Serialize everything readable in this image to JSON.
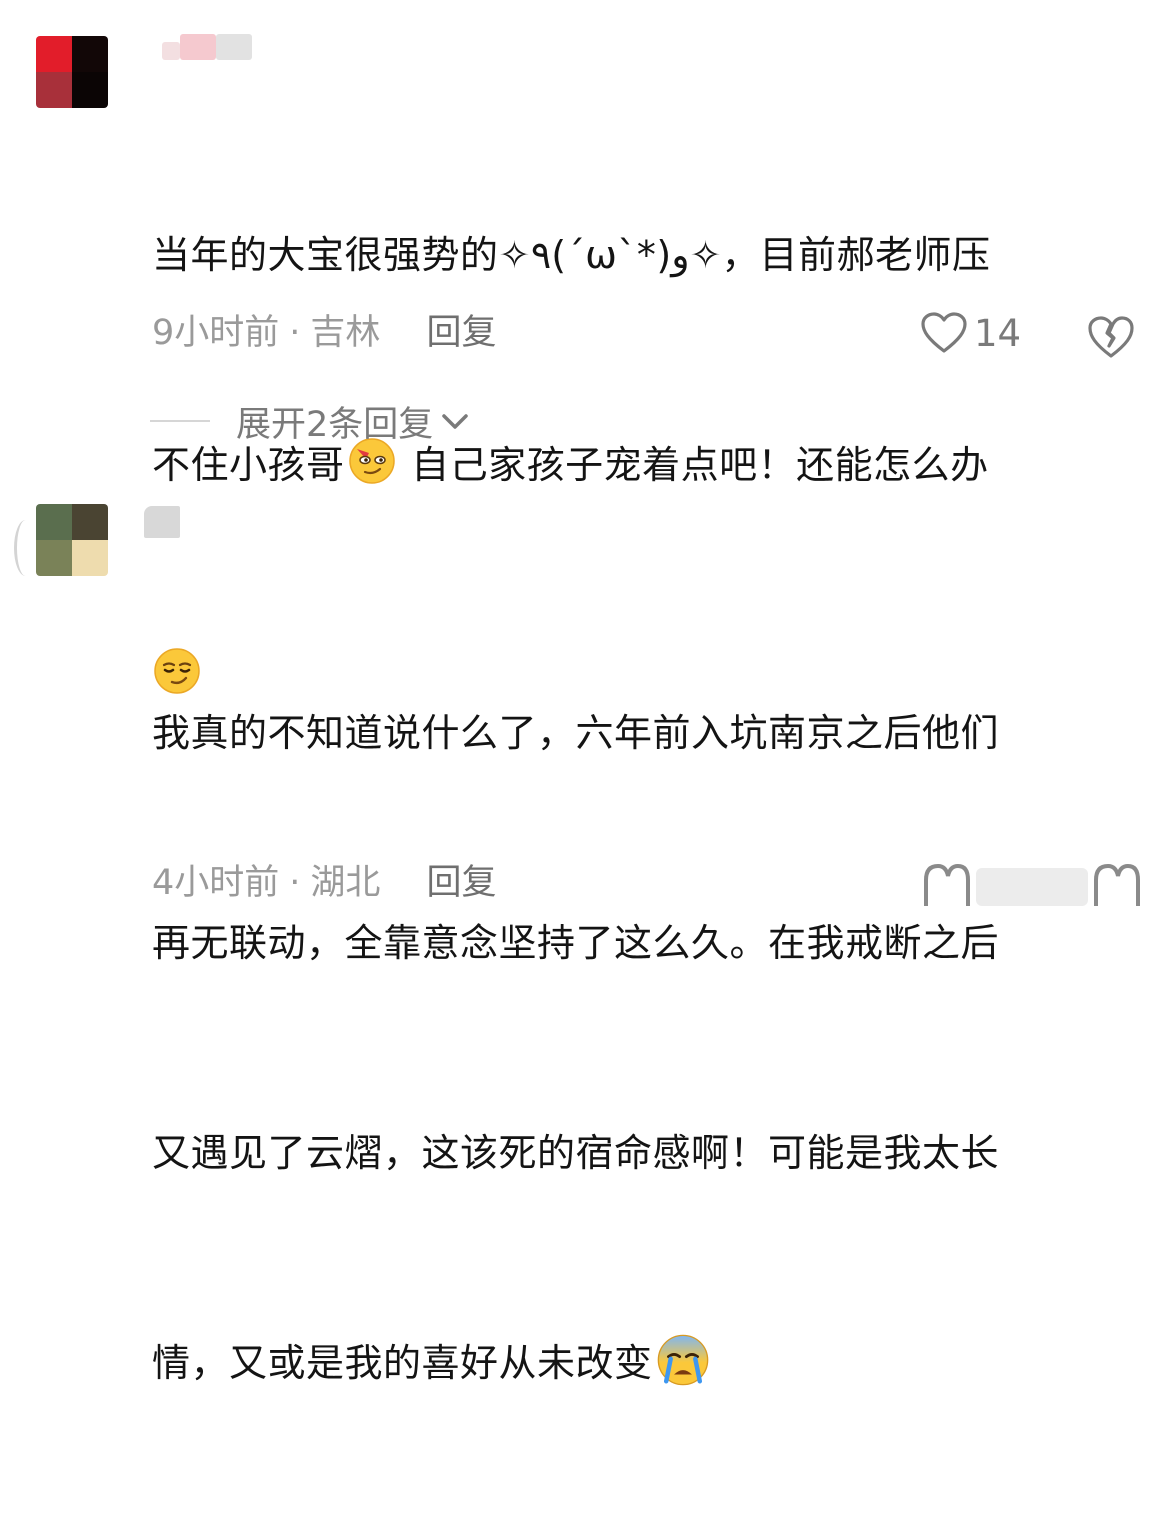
{
  "comments": [
    {
      "lines": [
        "当年的大宝很强势的✧٩(ˊωˋ*)و✧，目前郝老师压",
        "不住小孩哥",
        " 自己家孩子宠着点吧！还能怎么办"
      ],
      "emojis": [
        "smirking-face-emoji",
        "face-with-symbols-emoji"
      ],
      "time": "9小时前",
      "separator": "·",
      "location": "吉林",
      "reply_label": "回复",
      "likes": "14",
      "expand_label": "展开2条回复"
    },
    {
      "lines": [
        "我真的不知道说什么了，六年前入坑南京之后他们",
        "再无联动，全靠意念坚持了这么久。在我戒断之后",
        "又遇见了云熠，这该死的宿命感啊！可能是我太长",
        "情，又或是我的喜好从未改变"
      ],
      "emojis": [
        "crying-face-emoji"
      ],
      "time": "4小时前",
      "separator": "·",
      "location": "湖北",
      "reply_label": "回复"
    }
  ],
  "colors": {
    "text": "#141414",
    "meta": "#9a9a9a",
    "icon": "#7a7a7a"
  }
}
